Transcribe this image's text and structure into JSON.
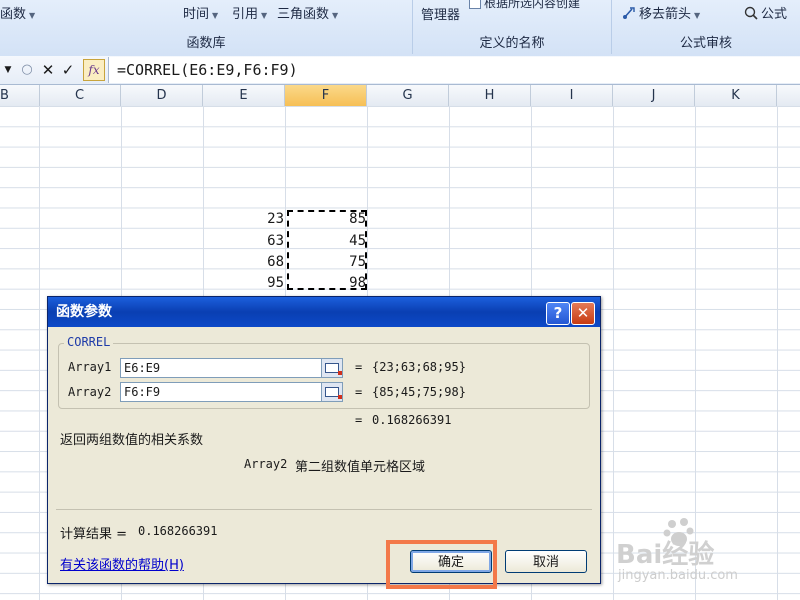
{
  "ribbon": {
    "function_library": {
      "partial_left": "函数",
      "time": "时间",
      "reference": "引用",
      "trig": "三角函数",
      "label": "函数库"
    },
    "defined_names": {
      "manager": "管理器",
      "create_from_selection": "根据所选内容创建",
      "label": "定义的名称"
    },
    "formula_auditing": {
      "remove_arrows": "移去箭头",
      "formula_partial": "公式",
      "label": "公式审核"
    }
  },
  "formula_bar": {
    "fx": "fx",
    "formula": "=CORREL(E6:E9,F6:F9)"
  },
  "columns": [
    "B",
    "C",
    "D",
    "E",
    "F",
    "G",
    "H",
    "I",
    "J",
    "K"
  ],
  "selected_column": "F",
  "cells": {
    "e": [
      "23",
      "63",
      "68",
      "95"
    ],
    "f": [
      "85",
      "45",
      "75",
      "98"
    ]
  },
  "dialog": {
    "title": "函数参数",
    "help_btn": "?",
    "close_btn": "✕",
    "function_name": "CORREL",
    "args": [
      {
        "label": "Array1",
        "value": "E6:E9",
        "result": "{23;63;68;95}"
      },
      {
        "label": "Array2",
        "value": "F6:F9",
        "result": "{85;45;75;98}"
      }
    ],
    "equals": "=",
    "formula_result": "0.168266391",
    "description": "返回两组数值的相关系数",
    "arg_help_name": "Array2",
    "arg_help_text": "第二组数值单元格区域",
    "calc_result_label": "计算结果 =",
    "calc_result_value": "0.168266391",
    "help_link": "有关该函数的帮助(H)",
    "ok_label": "确定",
    "cancel_label": "取消"
  },
  "watermark": {
    "brand": "Bai经验",
    "url": "jingyan.baidu.com"
  },
  "colors": {
    "title_bar": "#0a3fb2",
    "highlight": "#f3794a",
    "selected_column": "#f6bf55"
  }
}
